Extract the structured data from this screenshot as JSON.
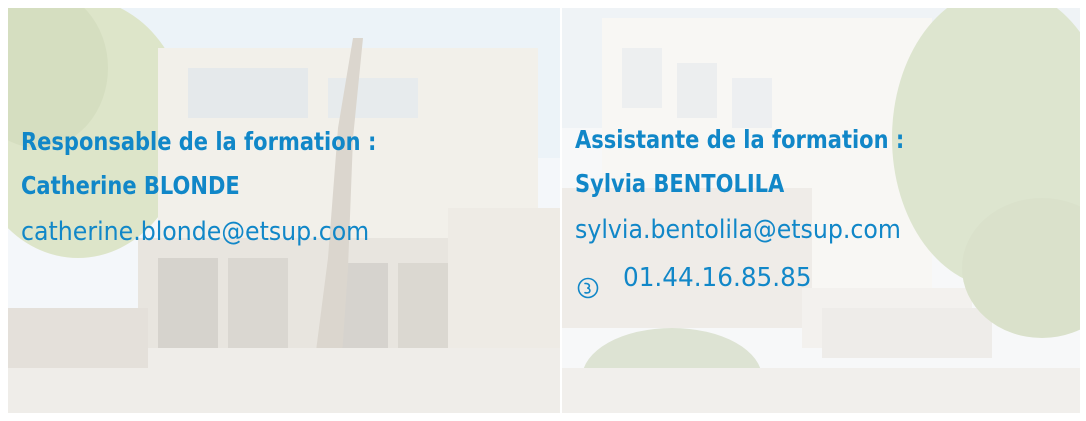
{
  "manager": {
    "title": "Responsable de la formation :",
    "name": "Catherine BLONDE",
    "email": "catherine.blonde@etsup.com"
  },
  "assistant": {
    "title": "Assistante de la formation :",
    "name": "Sylvia BENTOLILA",
    "email": "sylvia.bentolila@etsup.com",
    "phone_icon": "phone-icon",
    "phone": "01.44.16.85.85"
  },
  "colors": {
    "text": "#1187c8"
  }
}
